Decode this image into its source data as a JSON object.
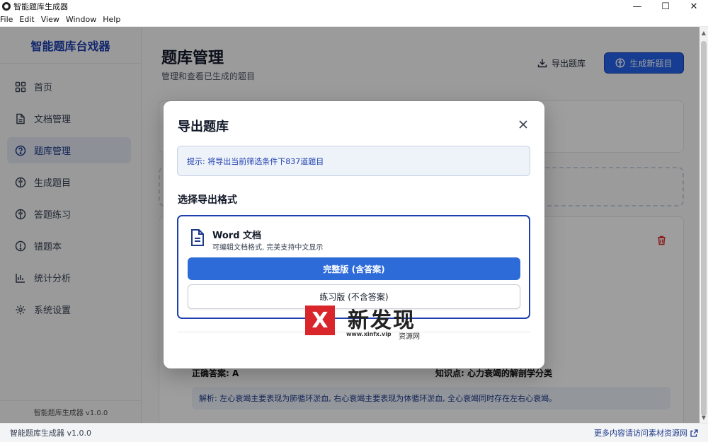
{
  "window": {
    "title": "智能题库生成器",
    "controls": {
      "minimize": "—",
      "maximize": "☐",
      "close": "✕"
    }
  },
  "menu": [
    "File",
    "Edit",
    "View",
    "Window",
    "Help"
  ],
  "sidebar": {
    "brand": "智能题库台戏器",
    "items": [
      {
        "label": "首页",
        "icon": "grid-icon",
        "active": false
      },
      {
        "label": "文档管理",
        "icon": "document-icon",
        "active": false
      },
      {
        "label": "题库管理",
        "icon": "question-icon",
        "active": true
      },
      {
        "label": "生成题目",
        "icon": "brain-icon",
        "active": false
      },
      {
        "label": "答题练习",
        "icon": "brain-icon",
        "active": false
      },
      {
        "label": "错题本",
        "icon": "alert-icon",
        "active": false
      },
      {
        "label": "统计分析",
        "icon": "bar-chart-icon",
        "active": false
      },
      {
        "label": "系统设置",
        "icon": "gear-icon",
        "active": false
      }
    ],
    "version": "智能题库生成器 v1.0.0"
  },
  "main": {
    "title": "题库管理",
    "subtitle": "管理和查看已生成的题目",
    "export_button": "导出题库",
    "generate_button": "生成新题目",
    "question": {
      "answer": "正确答案: A",
      "knowledge": "知识点: 心力衰竭的解剖学分类",
      "analysis": "解析: 左心衰竭主要表现为肺循环淤血, 右心衰竭主要表现为体循环淤血, 全心衰竭同时存在左右心衰竭。"
    }
  },
  "status_bar": {
    "left": "智能题库生成器 v1.0.0",
    "right": "更多内容请访问素材资源网"
  },
  "modal": {
    "title": "导出题库",
    "tip": "提示: 将导出当前筛选条件下837道题目",
    "format_heading": "选择导出格式",
    "format": {
      "name": "Word 文档",
      "description": "可编辑文档格式, 完美支持中文显示",
      "full_button": "完整版 (含答案)",
      "practice_button": "练习版 (不含答案)"
    }
  },
  "watermark": {
    "letter": "X",
    "title": "新发现",
    "url": "www.xinfx.vip",
    "suffix": "资源网"
  },
  "colors": {
    "primary": "#2563eb",
    "brand": "#1e40af",
    "danger": "#dc2626",
    "watermark_red": "#d9262a"
  }
}
